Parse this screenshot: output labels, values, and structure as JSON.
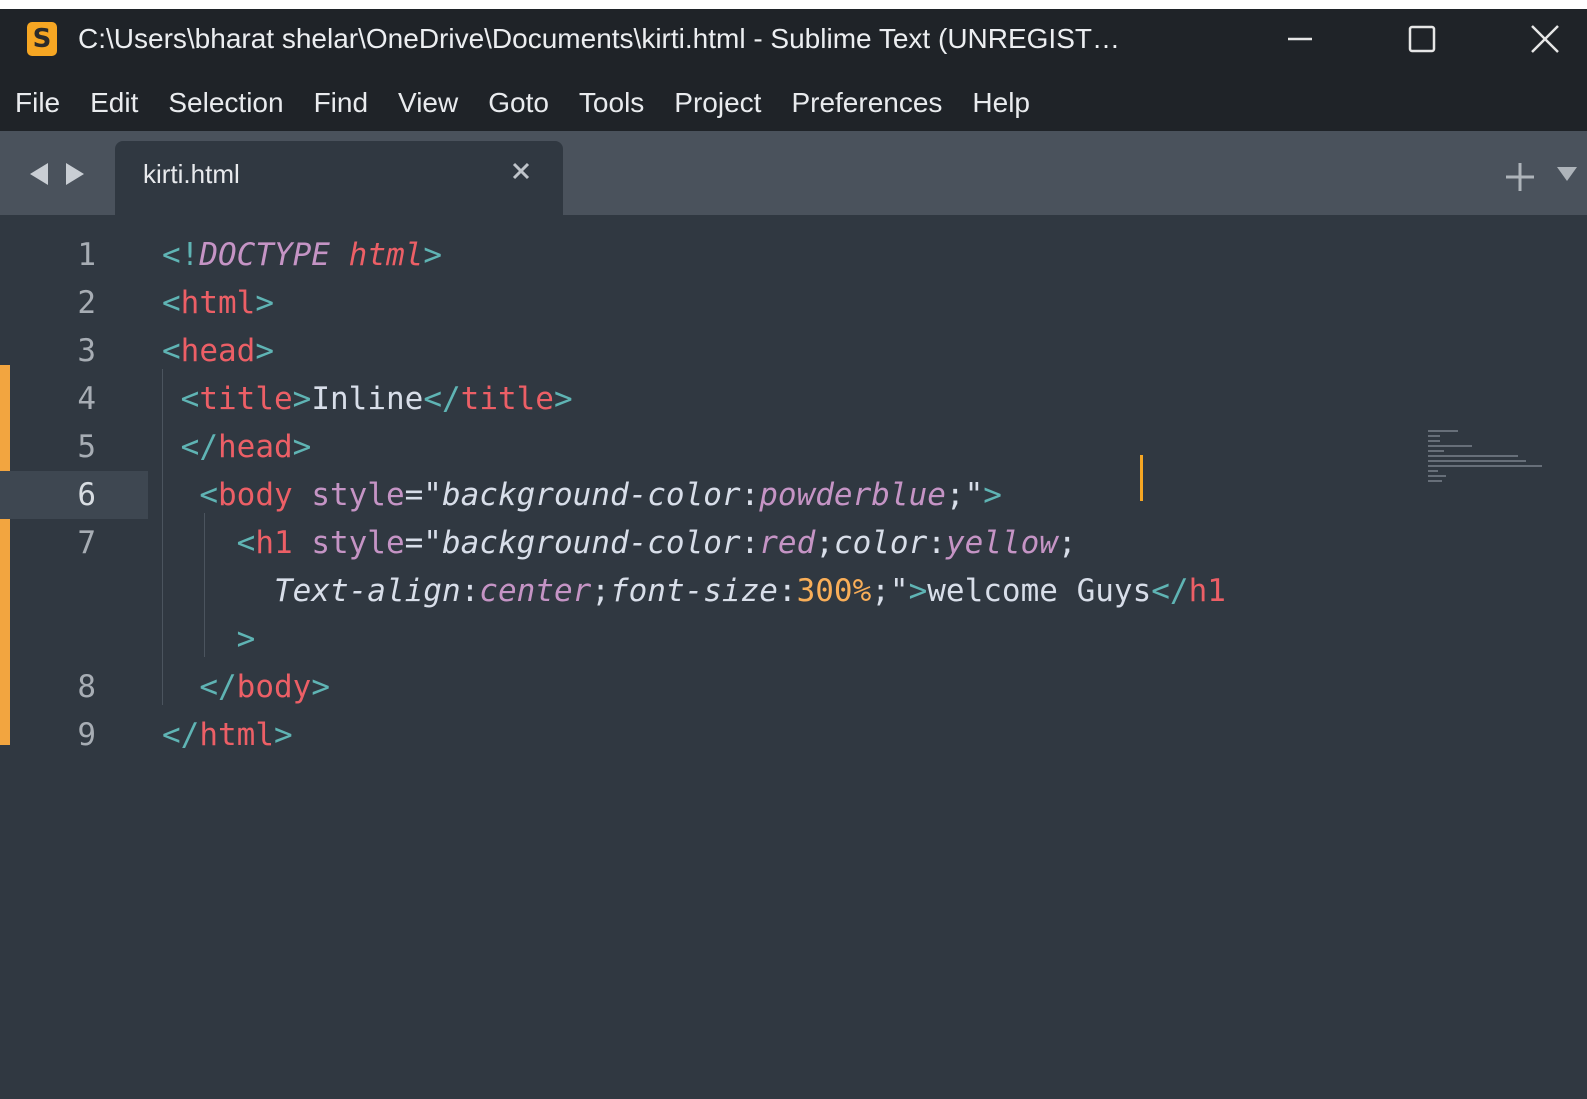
{
  "window": {
    "title": "C:\\Users\\bharat shelar\\OneDrive\\Documents\\kirti.html - Sublime Text (UNREGIST…",
    "minimize_icon": "minimize-icon",
    "maximize_icon": "maximize-icon",
    "close_icon": "close-icon"
  },
  "menu": [
    "File",
    "Edit",
    "Selection",
    "Find",
    "View",
    "Goto",
    "Tools",
    "Project",
    "Preferences",
    "Help"
  ],
  "tabs": [
    {
      "label": "kirti.html",
      "active": true
    }
  ],
  "editor": {
    "active_line": 6,
    "line_numbers": [
      "1",
      "2",
      "3",
      "4",
      "5",
      "6",
      "7",
      "",
      "",
      "8",
      "9"
    ],
    "lines": [
      {
        "number": "1",
        "segments": [
          {
            "text": "<!",
            "cls": "t-tag"
          },
          {
            "text": "DOCTYPE",
            "cls": "t-attr t-italic"
          },
          {
            "text": " ",
            "cls": "t-text"
          },
          {
            "text": "html",
            "cls": "t-name t-italic"
          },
          {
            "text": ">",
            "cls": "t-tag"
          }
        ]
      },
      {
        "number": "2",
        "segments": [
          {
            "text": "<",
            "cls": "t-tag"
          },
          {
            "text": "html",
            "cls": "t-name"
          },
          {
            "text": ">",
            "cls": "t-tag"
          }
        ]
      },
      {
        "number": "3",
        "segments": [
          {
            "text": "<",
            "cls": "t-tag"
          },
          {
            "text": "head",
            "cls": "t-name"
          },
          {
            "text": ">",
            "cls": "t-tag"
          }
        ]
      },
      {
        "number": "4",
        "segments": [
          {
            "text": " ",
            "cls": "t-text"
          },
          {
            "text": "<",
            "cls": "t-tag"
          },
          {
            "text": "title",
            "cls": "t-name"
          },
          {
            "text": ">",
            "cls": "t-tag"
          },
          {
            "text": "Inline",
            "cls": "t-text"
          },
          {
            "text": "</",
            "cls": "t-tag"
          },
          {
            "text": "title",
            "cls": "t-name"
          },
          {
            "text": ">",
            "cls": "t-tag"
          }
        ]
      },
      {
        "number": "5",
        "segments": [
          {
            "text": " ",
            "cls": "t-text"
          },
          {
            "text": "</",
            "cls": "t-tag"
          },
          {
            "text": "head",
            "cls": "t-name"
          },
          {
            "text": ">",
            "cls": "t-tag"
          }
        ]
      },
      {
        "number": "6",
        "segments": [
          {
            "text": "  ",
            "cls": "t-text"
          },
          {
            "text": "<",
            "cls": "t-tag"
          },
          {
            "text": "body",
            "cls": "t-name"
          },
          {
            "text": " style",
            "cls": "t-attr"
          },
          {
            "text": "=\"",
            "cls": "t-punct"
          },
          {
            "text": "background-color",
            "cls": "t-prop"
          },
          {
            "text": ":",
            "cls": "t-punct"
          },
          {
            "text": "powderblue",
            "cls": "t-val"
          },
          {
            "text": ";\"",
            "cls": "t-punct"
          },
          {
            "text": ">",
            "cls": "t-tag"
          }
        ]
      },
      {
        "number": "7",
        "segments": [
          {
            "text": "    ",
            "cls": "t-text"
          },
          {
            "text": "<",
            "cls": "t-tag"
          },
          {
            "text": "h1",
            "cls": "t-name"
          },
          {
            "text": " style",
            "cls": "t-attr"
          },
          {
            "text": "=\"",
            "cls": "t-punct"
          },
          {
            "text": "background-color",
            "cls": "t-prop"
          },
          {
            "text": ":",
            "cls": "t-punct"
          },
          {
            "text": "red",
            "cls": "t-val"
          },
          {
            "text": ";",
            "cls": "t-punct"
          },
          {
            "text": "color",
            "cls": "t-prop"
          },
          {
            "text": ":",
            "cls": "t-punct"
          },
          {
            "text": "yellow",
            "cls": "t-val"
          },
          {
            "text": ";",
            "cls": "t-punct"
          }
        ]
      },
      {
        "number": "",
        "segments": [
          {
            "text": "      ",
            "cls": "t-text"
          },
          {
            "text": "Text-align",
            "cls": "t-prop"
          },
          {
            "text": ":",
            "cls": "t-punct"
          },
          {
            "text": "center",
            "cls": "t-val"
          },
          {
            "text": ";",
            "cls": "t-punct"
          },
          {
            "text": "font-size",
            "cls": "t-prop"
          },
          {
            "text": ":",
            "cls": "t-punct"
          },
          {
            "text": "300%",
            "cls": "t-num"
          },
          {
            "text": ";\"",
            "cls": "t-punct"
          },
          {
            "text": ">",
            "cls": "t-tag"
          },
          {
            "text": "welcome Guys",
            "cls": "t-text"
          },
          {
            "text": "</",
            "cls": "t-tag"
          },
          {
            "text": "h1",
            "cls": "t-name"
          }
        ]
      },
      {
        "number": "",
        "segments": [
          {
            "text": "    ",
            "cls": "t-text"
          },
          {
            "text": ">",
            "cls": "t-tag"
          }
        ]
      },
      {
        "number": "8",
        "segments": [
          {
            "text": "  ",
            "cls": "t-text"
          },
          {
            "text": "</",
            "cls": "t-tag"
          },
          {
            "text": "body",
            "cls": "t-name"
          },
          {
            "text": ">",
            "cls": "t-tag"
          }
        ]
      },
      {
        "number": "9",
        "segments": [
          {
            "text": "</",
            "cls": "t-tag"
          },
          {
            "text": "html",
            "cls": "t-name"
          },
          {
            "text": ">",
            "cls": "t-tag"
          }
        ]
      }
    ]
  },
  "colors": {
    "titlebar_bg": "#1f2328",
    "tabbar_bg": "#4a525c",
    "editor_bg": "#303841",
    "modified_marker": "#f2a540",
    "cursor": "#f5a623"
  }
}
